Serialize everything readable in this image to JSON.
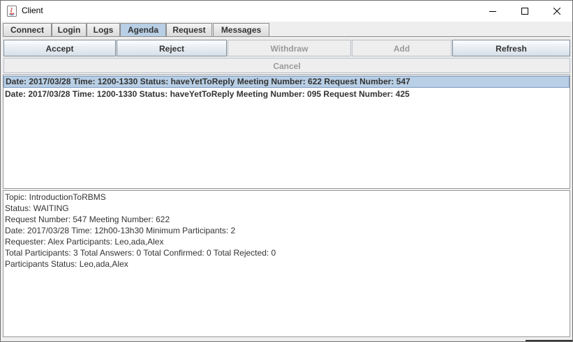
{
  "window": {
    "title": "Client"
  },
  "tabs": [
    {
      "label": "Connect",
      "selected": false
    },
    {
      "label": "Login",
      "selected": false
    },
    {
      "label": "Logs",
      "selected": false
    },
    {
      "label": "Agenda",
      "selected": true
    },
    {
      "label": "Request",
      "selected": false
    },
    {
      "label": "Messages",
      "selected": false
    }
  ],
  "toolbar": {
    "accept_label": "Accept",
    "reject_label": "Reject",
    "withdraw_label": "Withdraw",
    "add_label": "Add",
    "refresh_label": "Refresh",
    "cancel_label": "Cancel"
  },
  "agenda_list": {
    "items": [
      "Date: 2017/03/28 Time: 1200-1330 Status: haveYetToReply Meeting Number: 622 Request Number: 547",
      "Date: 2017/03/28 Time: 1200-1330 Status: haveYetToReply Meeting Number: 095 Request Number: 425"
    ],
    "selected_index": 0
  },
  "details": {
    "lines": [
      "Topic: IntroductionToRBMS",
      "Status: WAITING",
      "Request Number: 547 Meeting Number: 622",
      "Date: 2017/03/28 Time: 12h00-13h30 Minimum Participants: 2",
      "Requester: Alex Participants: Leo,ada,Alex",
      "Total Participants: 3 Total Answers: 0 Total Confirmed: 0 Total Rejected: 0",
      "Participants Status: Leo,ada,Alex"
    ]
  },
  "colors": {
    "selection": "#b8cfe5",
    "disabled_text": "#9a9a9a"
  }
}
